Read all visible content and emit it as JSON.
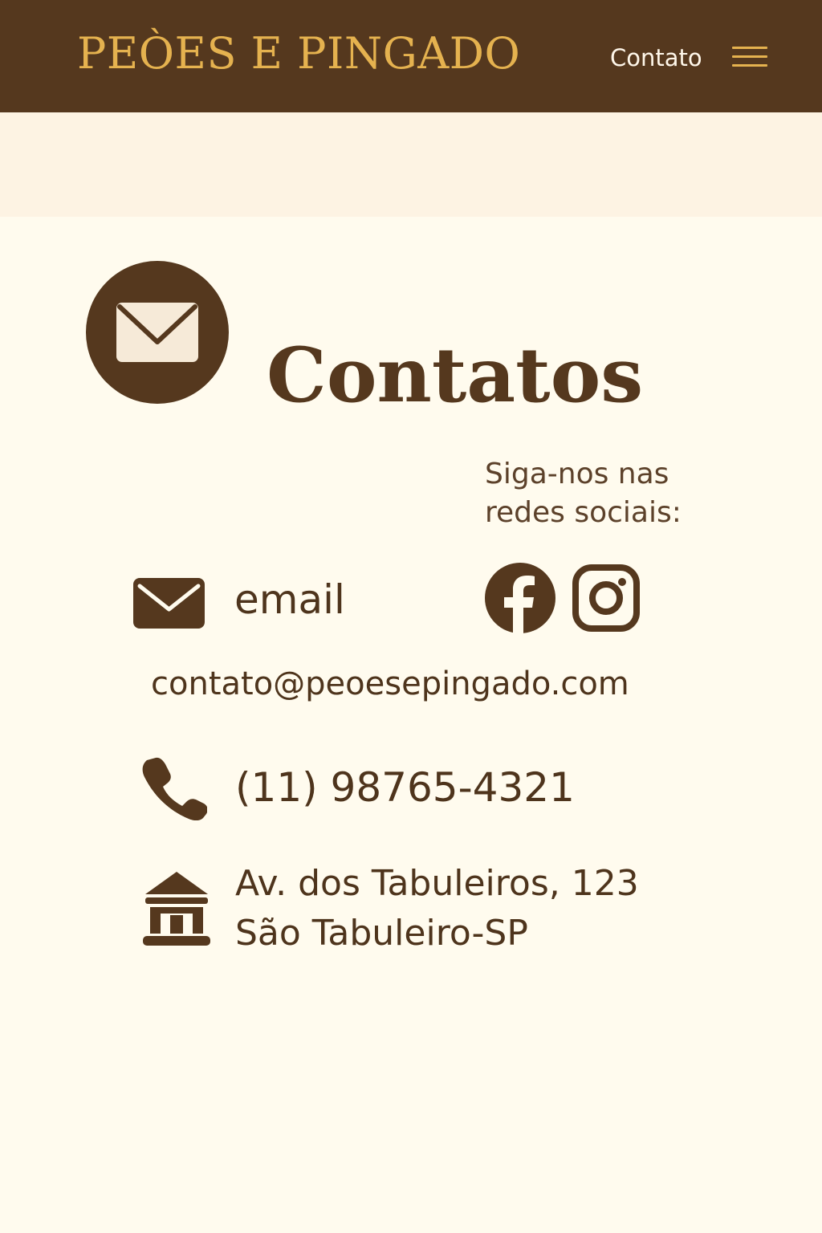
{
  "header": {
    "brand": "PEÒES E PINGADO",
    "nav_link": "Contato",
    "menu_icon": "hamburger-menu-icon"
  },
  "page": {
    "title": "Contatos",
    "title_icon": "envelope-circle-icon"
  },
  "social": {
    "heading_line1": "Siga-nos nas",
    "heading_line2": "redes sociais:",
    "icons": [
      "facebook-icon",
      "instagram-icon"
    ]
  },
  "contact": {
    "email_label": "email",
    "email_address": "contato@peoesepingado.com",
    "phone": "(11) 98765-4321",
    "address_line1": "Av. dos Tabuleiros, 123",
    "address_line2": "São Tabuleiro-SP",
    "icons": [
      "envelope-icon",
      "phone-icon",
      "building-icon"
    ]
  },
  "colors": {
    "header_background": "#55381e",
    "brand_text": "#e5b24f",
    "primary_text": "#4e341c",
    "page_background": "#fffbee",
    "top_band_background": "#fdf3e3",
    "icon_fill": "#55381e"
  }
}
